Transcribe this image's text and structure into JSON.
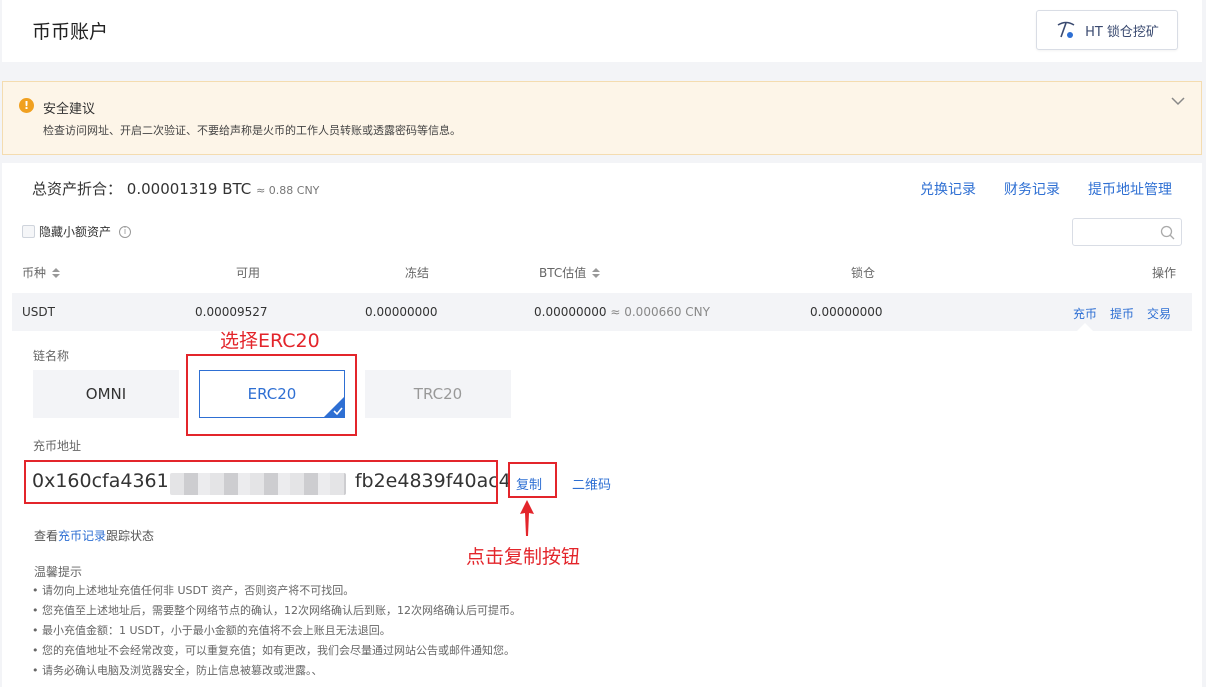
{
  "header": {
    "title": "币币账户",
    "ht_button": "HT 锁仓挖矿"
  },
  "notice": {
    "title": "安全建议",
    "text": "检查访问网址、开启二次验证、不要给声称是火币的工作人员转账或透露密码等信息。"
  },
  "summary": {
    "label": "总资产折合：",
    "btc": "0.00001319 BTC",
    "cny": "≈ 0.88 CNY",
    "links": [
      "兑换记录",
      "财务记录",
      "提币地址管理"
    ]
  },
  "filter": {
    "hide_small_label": "隐藏小额资产",
    "search_value": ""
  },
  "table": {
    "headers": [
      "币种",
      "可用",
      "冻结",
      "BTC估值",
      "锁仓",
      "操作"
    ],
    "row": {
      "coin": "USDT",
      "available": "0.00009527",
      "frozen": "0.00000000",
      "btc_value": "0.00000000",
      "btc_cny": "≈ 0.000660 CNY",
      "locked": "0.00000000",
      "actions": [
        "充币",
        "提币",
        "交易"
      ]
    }
  },
  "deposit": {
    "chain_label": "链名称",
    "chains": [
      "OMNI",
      "ERC20",
      "TRC20"
    ],
    "selected_chain": "ERC20",
    "address_label": "充币地址",
    "address_start": "0x160cfa43610",
    "address_end": "fb2e4839f40ac4",
    "copy_label": "复制",
    "qr_label": "二维码",
    "track_prefix": "查看",
    "track_link": "充币记录",
    "track_suffix": "跟踪状态",
    "tips_title": "温馨提示",
    "tips": [
      "• 请勿向上述地址充值任何非 USDT 资产，否则资产将不可找回。",
      "• 您充值至上述地址后，需要整个网络节点的确认，12次网络确认后到账，12次网络确认后可提币。",
      "• 最小充值金额：1 USDT，小于最小金额的充值将不会上账且无法退回。",
      "• 您的充值地址不会经常改变，可以重复充值；如有更改，我们会尽量通过网站公告或邮件通知您。",
      "• 请务必确认电脑及浏览器安全，防止信息被篡改或泄露。、"
    ]
  },
  "annotations": {
    "select_erc20": "选择ERC20",
    "click_copy": "点击复制按钮"
  },
  "colors": {
    "accent": "#2e6fd3",
    "annotation_red": "#e3252b",
    "warning": "#f0a020"
  }
}
